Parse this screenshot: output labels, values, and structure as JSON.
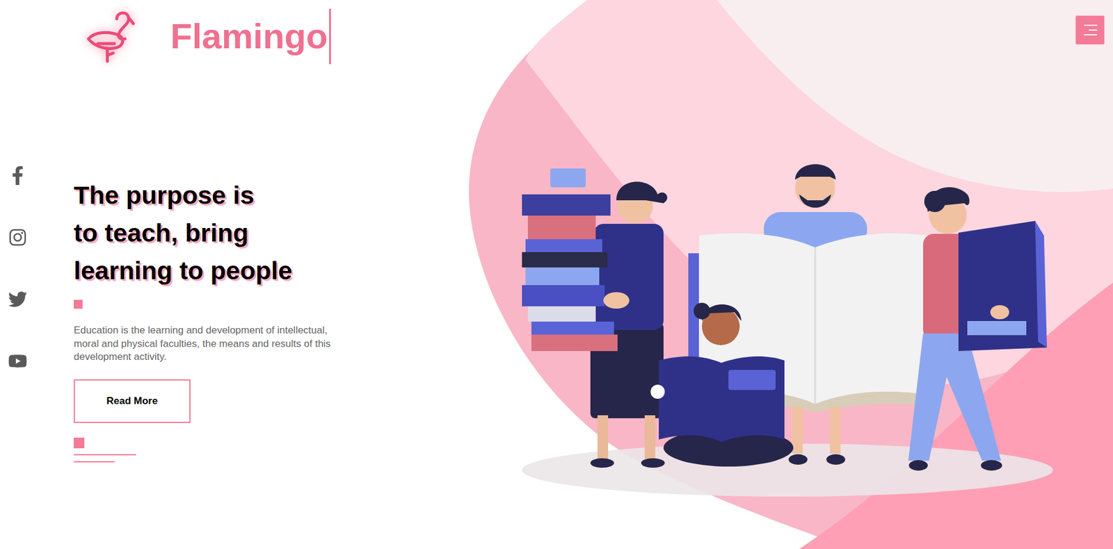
{
  "brand": {
    "name": "Flamingo"
  },
  "hero": {
    "heading": [
      "The purpose is",
      "to teach, bring",
      "learning to people"
    ],
    "description": "Education is the learning and development of intellectual, moral and physical faculties, the means and results of this development activity.",
    "button": "Read More"
  }
}
